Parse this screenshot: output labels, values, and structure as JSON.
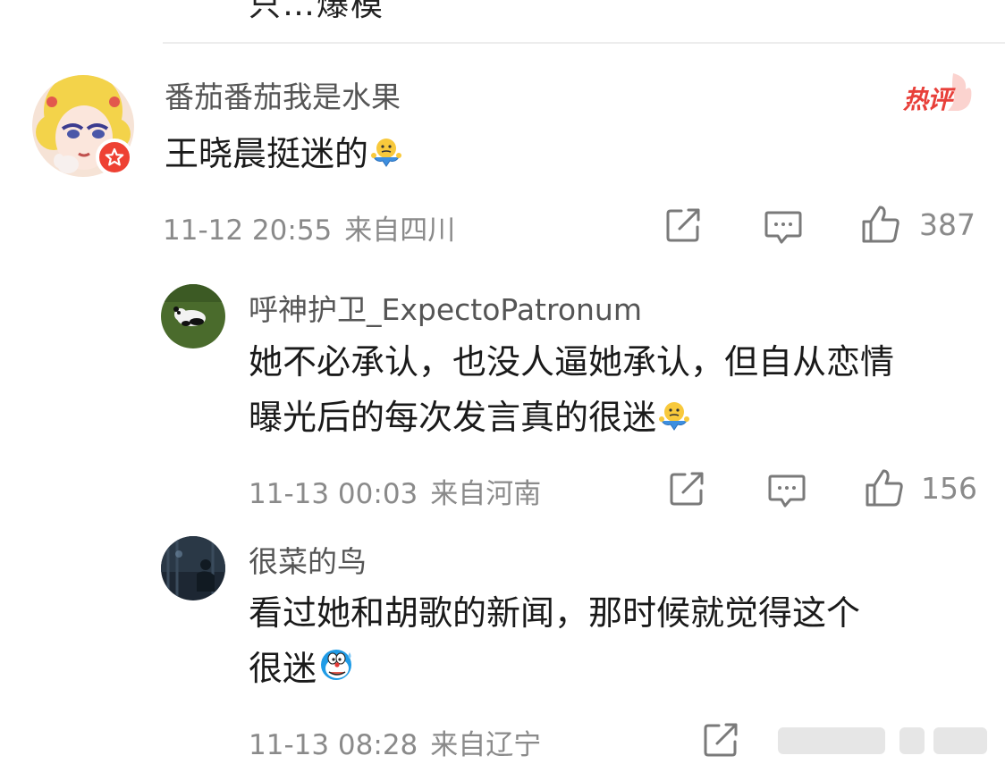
{
  "top_fragment": "只…爆模",
  "comments": [
    {
      "username": "番茄番茄我是水果",
      "text": "王晓晨挺迷的",
      "emoji": "shrug-emoji",
      "time": "11-12 20:55",
      "location": "来自四川",
      "likes": "387",
      "badge": "热评"
    },
    {
      "username": "呼神护卫_ExpectoPatronum",
      "text_lines": [
        "她不必承认，也没人逼她承认，但自从恋情",
        "曝光后的每次发言真的很迷"
      ],
      "emoji": "shrug-emoji",
      "time": "11-13 00:03",
      "location": "来自河南",
      "likes": "156"
    },
    {
      "username": "很菜的鸟",
      "text_lines": [
        "看过她和胡歌的新闻，那时候就觉得这个",
        "很迷"
      ],
      "emoji": "doraemon-sweat-emoji",
      "time": "11-13 08:28",
      "location": "来自辽宁",
      "likes": ""
    }
  ],
  "colors": {
    "hot_badge": "#e8403a",
    "vip_badge": "#ee4133",
    "meta_text": "#8a8a8a",
    "username_text": "#555555"
  }
}
